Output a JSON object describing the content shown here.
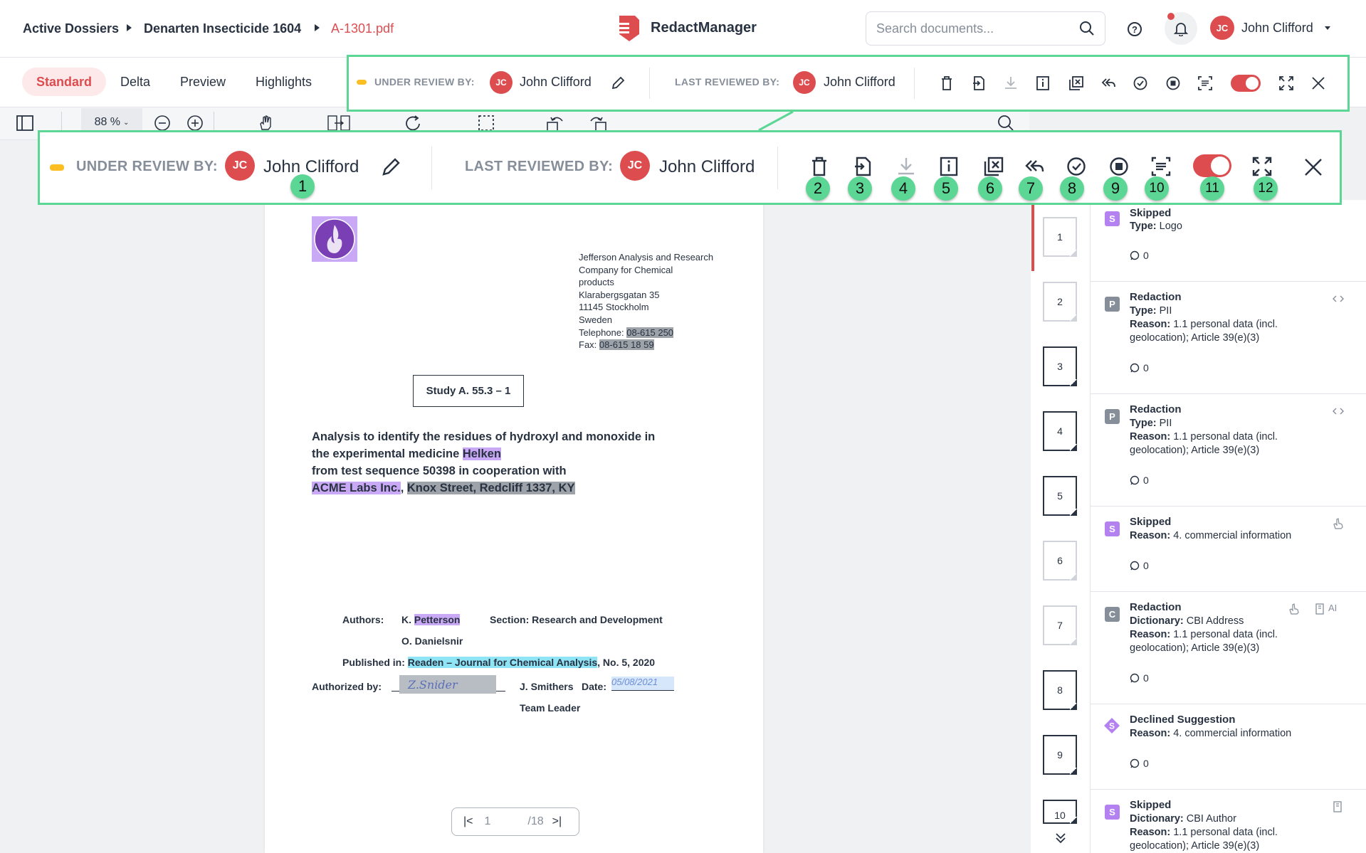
{
  "breadcrumb": {
    "items": [
      "Active Dossiers",
      "Denarten Insecticide 1604",
      "A-1301.pdf"
    ]
  },
  "app": {
    "name": "RedactManager"
  },
  "search": {
    "placeholder": "Search documents..."
  },
  "user": {
    "initials": "JC",
    "name": "John Clifford"
  },
  "tabs": [
    "Standard",
    "Delta",
    "Preview",
    "Highlights"
  ],
  "zoom": {
    "value": "88 %"
  },
  "review": {
    "under_review_label": "UNDER REVIEW BY:",
    "under_review_initials": "JC",
    "under_review_name": "John Clifford",
    "last_reviewed_label": "LAST REVIEWED BY:",
    "last_reviewed_initials": "JC",
    "last_reviewed_name": "John Clifford"
  },
  "callout_numbers": [
    "1",
    "2",
    "3",
    "4",
    "5",
    "6",
    "7",
    "8",
    "9",
    "10",
    "11",
    "12"
  ],
  "document": {
    "address": [
      "Jefferson Analysis and Research",
      "Company for Chemical",
      "products",
      "Klarabergsgatan 35",
      "11145 Stockholm",
      "Sweden"
    ],
    "telephone_label": "Telephone:",
    "telephone": "08-615 250",
    "fax_label": "Fax:",
    "fax": "08-615 18 59",
    "study": "Study A. 55.3 – 1",
    "title_line1": "Analysis to identify the residues of hydroxyl and monoxide in",
    "title_line2_pre": "the experimental medicine ",
    "title_line2_hl": "Helken",
    "title_line3": "from test sequence 50398 in cooperation with",
    "title_line4_hl1": "ACME Labs Inc.",
    "title_line4_sep": ", ",
    "title_line4_hl2": "Knox Street, Redcliff 1337, KY",
    "authors_label": "Authors:",
    "author1_pre": "K. ",
    "author1_hl": "Petterson",
    "author2": "O. Danielsnir",
    "section": "Section: Research and Development",
    "published_label": "Published in: ",
    "published_hl": "Readen – Journal for Chemical Analysis",
    "published_post": ", No. 5, 2020",
    "authorized_label": "Authorized by:",
    "signature": "Z.Snider",
    "smithers": "J. Smithers",
    "date_label": "Date:",
    "date_value": "05/08/2021",
    "team_leader": "Team Leader"
  },
  "pagination": {
    "current": "1",
    "total": "/18"
  },
  "thumbnails": [
    "1",
    "2",
    "3",
    "4",
    "5",
    "6",
    "7",
    "8",
    "9",
    "10"
  ],
  "annotations": [
    {
      "badge": "S",
      "color": "#b481f0",
      "title": "Skipped",
      "lines": [
        {
          "k": "Type:",
          "v": " Logo"
        }
      ],
      "comments": "0"
    },
    {
      "badge": "P",
      "color": "#868e99",
      "title": "Redaction",
      "lines": [
        {
          "k": "Type:",
          "v": " PII"
        },
        {
          "k": "Reason:",
          "v": " 1.1 personal data (incl. geolocation); Article 39(e)(3)"
        }
      ],
      "comments": "0"
    },
    {
      "badge": "P",
      "color": "#868e99",
      "title": "Redaction",
      "lines": [
        {
          "k": "Type:",
          "v": " PII"
        },
        {
          "k": "Reason:",
          "v": " 1.1 personal data (incl. geolocation); Article 39(e)(3)"
        }
      ],
      "comments": "0"
    },
    {
      "badge": "S",
      "color": "#b481f0",
      "title": "Skipped",
      "lines": [
        {
          "k": "Reason:",
          "v": " 4. commercial information"
        }
      ],
      "comments": "0"
    },
    {
      "badge": "C",
      "color": "#868e99",
      "title": "Redaction",
      "lines": [
        {
          "k": "Dictionary:",
          "v": " CBI Address"
        },
        {
          "k": "Reason:",
          "v": " 1.1 personal data (incl. geolocation); Article 39(e)(3)"
        }
      ],
      "comments": "0",
      "ai": "AI"
    },
    {
      "badge": "S",
      "color": "#b481f0",
      "title": "Declined Suggestion",
      "lines": [
        {
          "k": "Reason:",
          "v": " 4. commercial information"
        }
      ],
      "comments": "0"
    },
    {
      "badge": "S",
      "color": "#b481f0",
      "title": "Skipped",
      "lines": [
        {
          "k": "Dictionary:",
          "v": " CBI Author"
        },
        {
          "k": "Reason:",
          "v": " 1.1 personal data (incl. geolocation); Article 39(e)(3)"
        }
      ],
      "comments": ""
    }
  ],
  "colors": {
    "accent": "#dd4d50",
    "callout": "#5cd694",
    "review_bar": "#fbbf24"
  }
}
